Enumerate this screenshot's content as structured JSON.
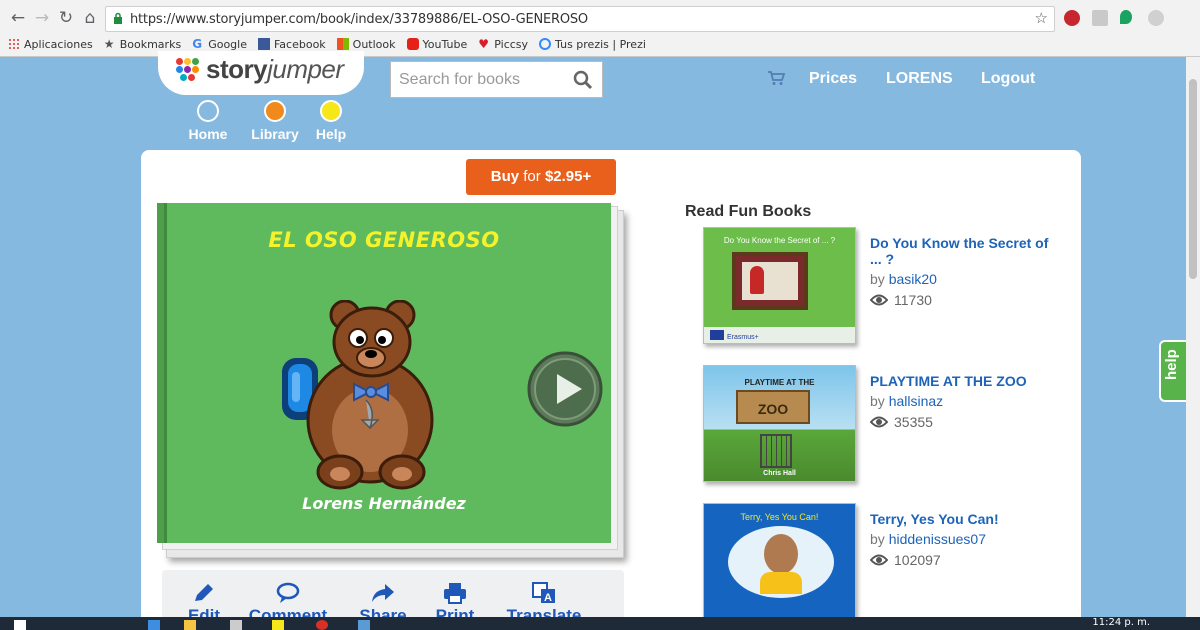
{
  "browser": {
    "url": "https://www.storyjumper.com/book/index/33789886/EL-OSO-GENEROSO",
    "bookmarks": [
      {
        "label": "Aplicaciones",
        "icon": "apps-grid-icon",
        "color": "#d93025"
      },
      {
        "label": "Bookmarks",
        "icon": "star-icon",
        "color": "#555555"
      },
      {
        "label": "Google",
        "icon": "google-icon",
        "color": "#4285f4"
      },
      {
        "label": "Facebook",
        "icon": "facebook-icon",
        "color": "#3b5998"
      },
      {
        "label": "Outlook",
        "icon": "outlook-icon",
        "color": "#0072c6"
      },
      {
        "label": "YouTube",
        "icon": "youtube-icon",
        "color": "#e62117"
      },
      {
        "label": "Piccsy",
        "icon": "heart-icon",
        "color": "#d81e2a"
      },
      {
        "label": "Tus prezis | Prezi",
        "icon": "prezi-icon",
        "color": "#318bff"
      }
    ]
  },
  "header": {
    "logo_story": "story",
    "logo_jumper": "jumper",
    "search_placeholder": "Search for books",
    "nav": {
      "prices": "Prices",
      "user": "LORENS",
      "logout": "Logout"
    },
    "circle_nav": [
      {
        "label": "Home",
        "color": "#86b9e0"
      },
      {
        "label": "Library",
        "color": "#f08a1c"
      },
      {
        "label": "Help",
        "color": "#f6e71a"
      }
    ]
  },
  "book": {
    "buy_prefix": "Buy",
    "buy_for": " for ",
    "buy_price": "$2.95+",
    "title": "EL OSO GENEROSO",
    "author": "Lorens Hernández"
  },
  "actions": [
    {
      "label": "Edit",
      "icon": "pencil-icon"
    },
    {
      "label": "Comment",
      "icon": "speech-bubble-icon"
    },
    {
      "label": "Share",
      "icon": "share-arrow-icon"
    },
    {
      "label": "Print",
      "icon": "printer-icon"
    },
    {
      "label": "Translate",
      "icon": "translate-icon"
    }
  ],
  "read_fun_books": {
    "heading": "Read Fun Books",
    "items": [
      {
        "title": "Do You Know the Secret of ... ?",
        "thumb_caption": "Do You Know the Secret of ... ?",
        "thumb_footer": "Erasmus+",
        "by": "by",
        "author": "basik20",
        "views": "11730"
      },
      {
        "title": "PLAYTIME AT THE ZOO",
        "thumb_caption": "PLAYTIME AT THE",
        "thumb_sign": "ZOO",
        "thumb_footer": "Chris Hall",
        "by": "by",
        "author": "hallsinaz",
        "views": "35355"
      },
      {
        "title": "Terry, Yes You Can!",
        "thumb_caption": "Terry, Yes You Can!",
        "by": "by",
        "author": "hiddenissues07",
        "views": "102097"
      }
    ]
  },
  "help_tab": "help",
  "taskbar": {
    "clock": "11:24 p. m."
  }
}
